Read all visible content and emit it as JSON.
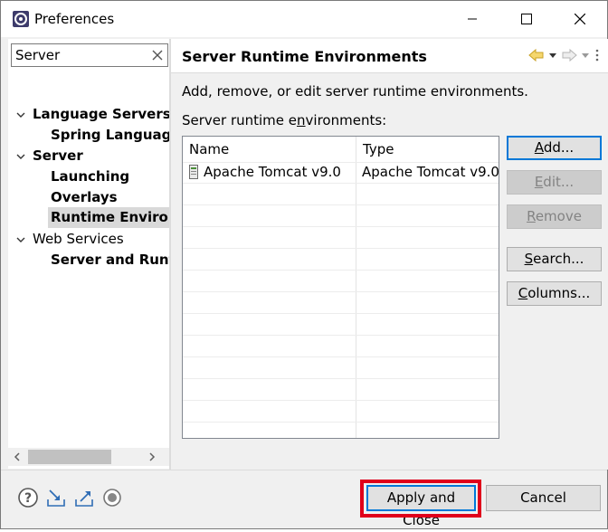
{
  "window": {
    "title": "Preferences",
    "controls": [
      "minimize-icon",
      "maximize-icon",
      "close-icon"
    ]
  },
  "filter": {
    "value": "Server",
    "clear_icon": "clear-filter-icon"
  },
  "tree": {
    "items": [
      {
        "label": "Language Servers",
        "expanded": true,
        "bold": true
      },
      {
        "label": "Spring Language",
        "bold": true
      },
      {
        "label": "Server",
        "expanded": true,
        "bold": true
      },
      {
        "label": "Launching",
        "bold": true
      },
      {
        "label": "Overlays",
        "bold": true
      },
      {
        "label": "Runtime Environ",
        "bold": true,
        "selected": true
      },
      {
        "label": "Web Services",
        "expanded": true,
        "bold": false
      },
      {
        "label": "Server and Runti",
        "bold": true
      }
    ]
  },
  "page": {
    "title": "Server Runtime Environments",
    "description": "Add, remove, or edit server runtime environments.",
    "list_label_pre": "Server runtime e",
    "list_label_mnemonic": "n",
    "list_label_post": "vironments:",
    "nav_icons": [
      "back-arrow-icon",
      "back-dropdown-icon",
      "forward-arrow-icon",
      "forward-dropdown-icon",
      "view-menu-icon"
    ]
  },
  "table": {
    "columns": [
      "Name",
      "Type"
    ],
    "rows": [
      {
        "name": "Apache Tomcat v9.0",
        "type": "Apache Tomcat v9.0",
        "checked": true
      }
    ]
  },
  "buttons": {
    "add": {
      "mnemonic": "A",
      "rest": "dd..."
    },
    "edit": {
      "mnemonic": "E",
      "rest": "dit...",
      "disabled": true
    },
    "remove": {
      "mnemonic": "R",
      "rest": "emove",
      "disabled": true
    },
    "search": {
      "mnemonic": "S",
      "rest": "earch..."
    },
    "columns": {
      "mnemonic": "C",
      "rest": "olumns..."
    }
  },
  "footer": {
    "icons": [
      "help-icon",
      "import-icon",
      "export-icon",
      "record-icon"
    ],
    "apply_close": "Apply and Close",
    "cancel": "Cancel"
  },
  "colors": {
    "default_button_border": "#0078d7",
    "highlight_box": "#e0001b",
    "selection": "#d9d9d9"
  }
}
